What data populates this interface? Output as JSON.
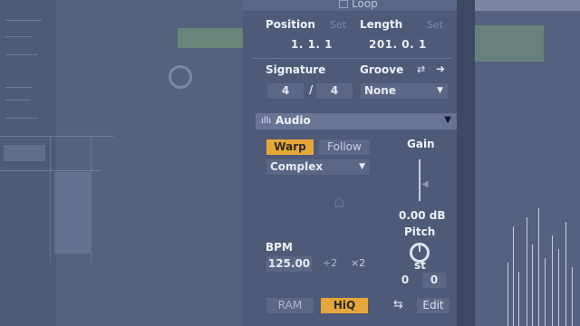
{
  "loop": {
    "label": "Loop"
  },
  "position": {
    "label": "Position",
    "set_label": "Set",
    "value": "1.   1.   1"
  },
  "length": {
    "label": "Length",
    "set_label": "Set",
    "value": "201.   0.   1"
  },
  "signature": {
    "label": "Signature",
    "numerator": "4",
    "separator": "/",
    "denominator": "4"
  },
  "groove": {
    "label": "Groove",
    "value": "None"
  },
  "audio": {
    "title": "Audio"
  },
  "warp": {
    "warp_label": "Warp",
    "follow_label": "Follow",
    "mode": "Complex"
  },
  "gain": {
    "label": "Gain",
    "value": "0.00 dB"
  },
  "pitch": {
    "label": "Pitch",
    "unit": "st",
    "semitones": "0",
    "cents": "0"
  },
  "bpm": {
    "label": "BPM",
    "value": "125.00",
    "half_label": "÷2",
    "double_label": "×2"
  },
  "bottom": {
    "ram_label": "RAM",
    "hiq_label": "HiQ",
    "edit_label": "Edit"
  },
  "colors": {
    "accent": "#e6a73a",
    "panel": "#4e5a78",
    "field": "#5c6786"
  },
  "icons": [
    "loop-box-icon",
    "groove-hot-swap-icon",
    "groove-arrow-icon",
    "waveform-icon",
    "chevron-down-icon",
    "swap-icon"
  ]
}
